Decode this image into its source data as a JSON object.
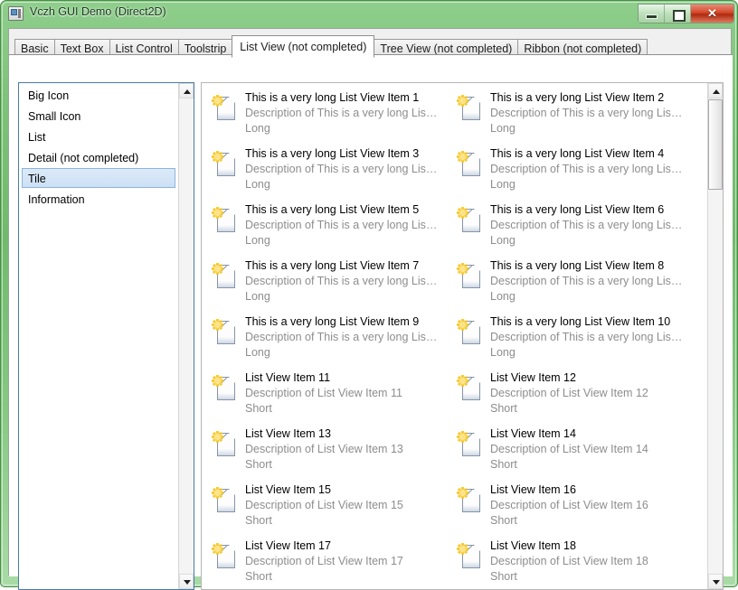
{
  "window": {
    "title": "Vczh GUI Demo (Direct2D)",
    "icon": "app-window-icon",
    "buttons": {
      "minimize": "minimize-icon",
      "maximize": "maximize-icon",
      "close": "✕"
    },
    "frame_color": "#7cc278",
    "close_color": "#d4472a"
  },
  "tabs": [
    {
      "label": "Basic",
      "active": false
    },
    {
      "label": "Text Box",
      "active": false
    },
    {
      "label": "List Control",
      "active": false
    },
    {
      "label": "Toolstrip",
      "active": false
    },
    {
      "label": "List View (not completed)",
      "active": true
    },
    {
      "label": "Tree View (not completed)",
      "active": false
    },
    {
      "label": "Ribbon (not completed)",
      "active": false
    }
  ],
  "mode_list": {
    "selected": "Tile",
    "selection_color": "#cde0f4",
    "items": [
      {
        "label": "Big Icon"
      },
      {
        "label": "Small Icon"
      },
      {
        "label": "List"
      },
      {
        "label": "Detail (not completed)"
      },
      {
        "label": "Tile"
      },
      {
        "label": "Information"
      }
    ]
  },
  "list_view": {
    "view_mode": "Tile",
    "icon": "new-document-icon",
    "items": [
      {
        "title": "This is a very long List View Item 1",
        "description": "Description of This is a very long Lis…",
        "size": "Long"
      },
      {
        "title": "This is a very long List View Item 2",
        "description": "Description of This is a very long Lis…",
        "size": "Long"
      },
      {
        "title": "This is a very long List View Item 3",
        "description": "Description of This is a very long Lis…",
        "size": "Long"
      },
      {
        "title": "This is a very long List View Item 4",
        "description": "Description of This is a very long Lis…",
        "size": "Long"
      },
      {
        "title": "This is a very long List View Item 5",
        "description": "Description of This is a very long Lis…",
        "size": "Long"
      },
      {
        "title": "This is a very long List View Item 6",
        "description": "Description of This is a very long Lis…",
        "size": "Long"
      },
      {
        "title": "This is a very long List View Item 7",
        "description": "Description of This is a very long Lis…",
        "size": "Long"
      },
      {
        "title": "This is a very long List View Item 8",
        "description": "Description of This is a very long Lis…",
        "size": "Long"
      },
      {
        "title": "This is a very long List View Item 9",
        "description": "Description of This is a very long Lis…",
        "size": "Long"
      },
      {
        "title": "This is a very long List View Item 10",
        "description": "Description of This is a very long Lis…",
        "size": "Long"
      },
      {
        "title": "List View Item 11",
        "description": "Description of List View Item 11",
        "size": "Short"
      },
      {
        "title": "List View Item 12",
        "description": "Description of List View Item 12",
        "size": "Short"
      },
      {
        "title": "List View Item 13",
        "description": "Description of List View Item 13",
        "size": "Short"
      },
      {
        "title": "List View Item 14",
        "description": "Description of List View Item 14",
        "size": "Short"
      },
      {
        "title": "List View Item 15",
        "description": "Description of List View Item 15",
        "size": "Short"
      },
      {
        "title": "List View Item 16",
        "description": "Description of List View Item 16",
        "size": "Short"
      },
      {
        "title": "List View Item 17",
        "description": "Description of List View Item 17",
        "size": "Short"
      },
      {
        "title": "List View Item 18",
        "description": "Description of List View Item 18",
        "size": "Short"
      }
    ]
  },
  "scrollbars": {
    "left_list": {
      "up_arrow": "scroll-up-icon",
      "down_arrow": "scroll-down-icon",
      "thumb_visible": false
    },
    "list_view": {
      "up_arrow": "scroll-up-icon",
      "down_arrow": "scroll-down-icon",
      "thumb_visible": true
    }
  }
}
